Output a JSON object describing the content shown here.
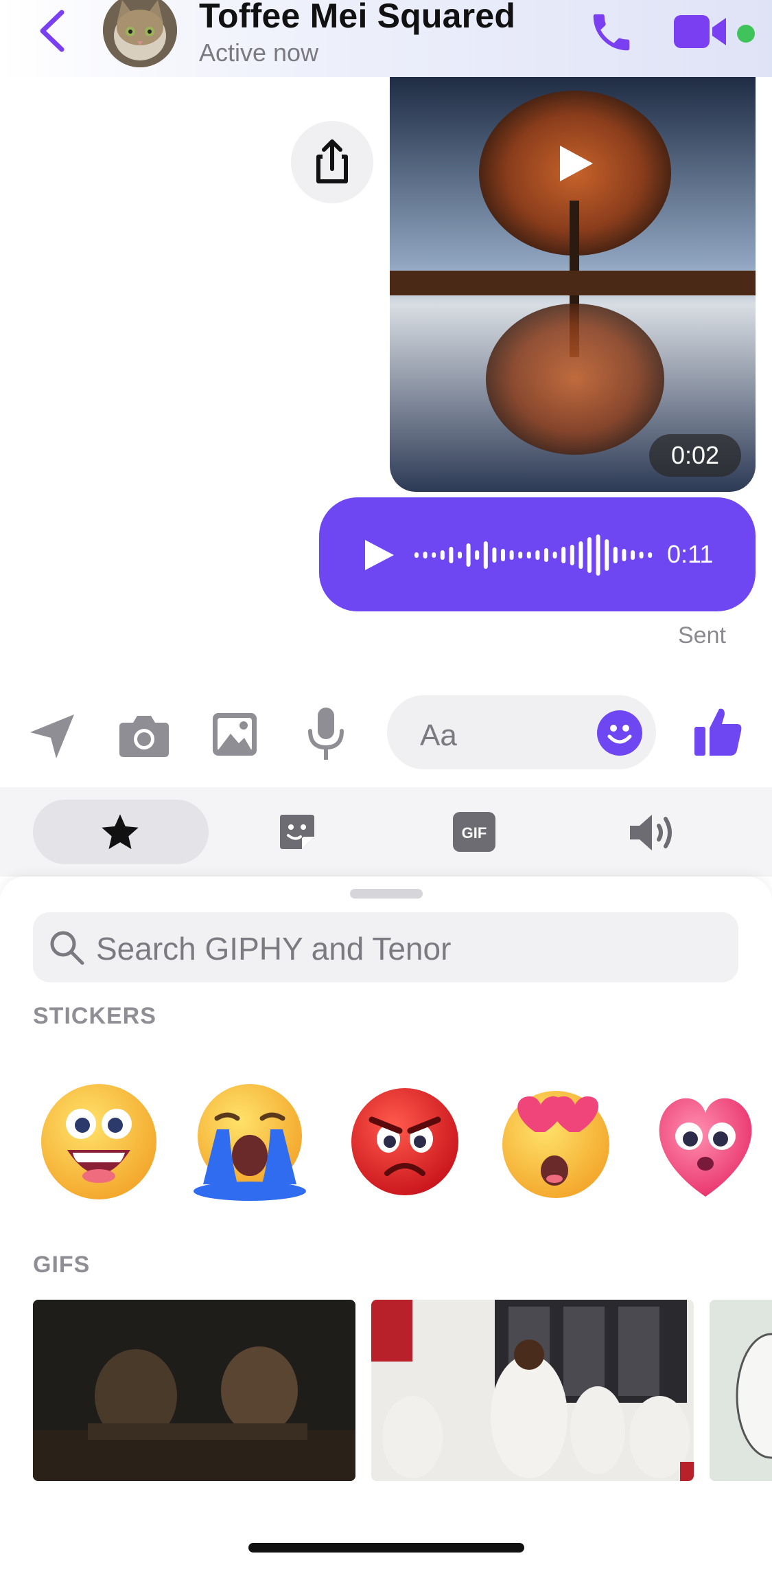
{
  "header": {
    "contact_name": "Toffee Mei Squared",
    "status": "Active now",
    "accent_color": "#7b3ff2",
    "online_color": "#3fc45b"
  },
  "messages": {
    "video": {
      "duration": "0:02"
    },
    "voice": {
      "duration": "0:11",
      "bubble_color": "#6e46f2"
    },
    "status": "Sent"
  },
  "composer": {
    "placeholder": "Aa",
    "icons": [
      "send-location-icon",
      "camera-icon",
      "gallery-icon",
      "microphone-icon",
      "emoji-icon",
      "thumbs-up-icon"
    ]
  },
  "tabs": [
    {
      "name": "favorites",
      "icon": "star-icon",
      "selected": true
    },
    {
      "name": "stickers",
      "icon": "sticker-icon",
      "selected": false
    },
    {
      "name": "gifs",
      "icon": "gif-icon",
      "selected": false
    },
    {
      "name": "sounds",
      "icon": "speaker-icon",
      "selected": false
    }
  ],
  "search": {
    "placeholder": "Search GIPHY and Tenor"
  },
  "sections": {
    "stickers": "STICKERS",
    "gifs": "GIFS"
  },
  "stickers": [
    "happy-face-sticker",
    "crying-face-sticker",
    "angry-face-sticker",
    "heart-eyes-sticker",
    "heart-face-sticker"
  ],
  "gifs": [
    "gif-forest-men",
    "gif-basketball-team",
    "gif-partial"
  ]
}
